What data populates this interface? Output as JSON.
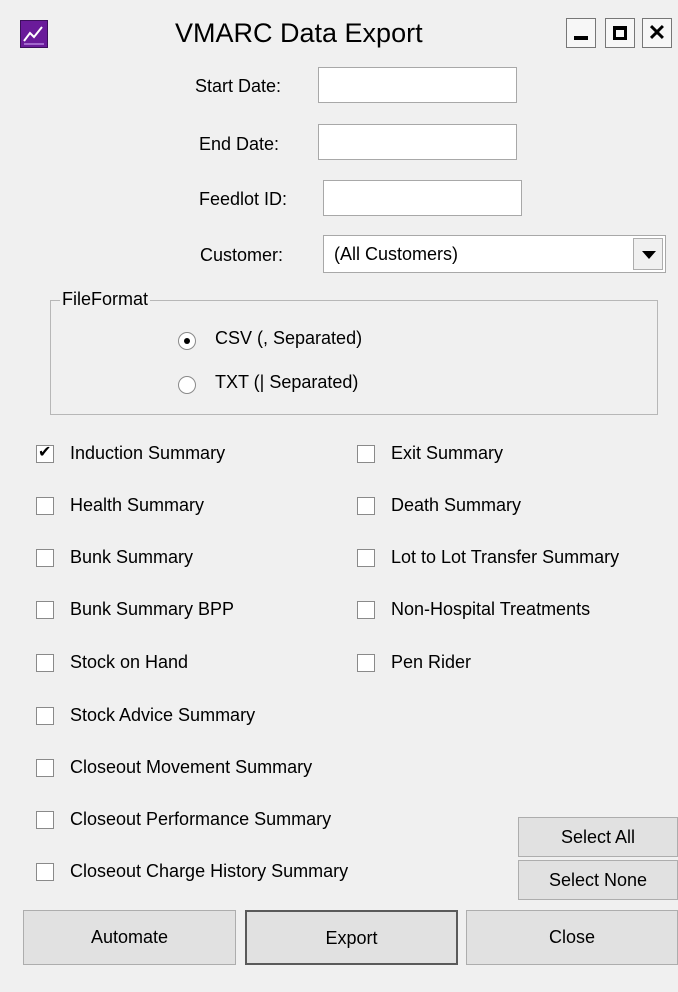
{
  "window": {
    "title": "VMARC Data Export",
    "icon": "chart-app-icon"
  },
  "title_buttons": {
    "minimize": "minimize-icon",
    "maximize": "maximize-icon",
    "close": "close-icon"
  },
  "fields": {
    "start_date": {
      "label": "Start Date:",
      "value": ""
    },
    "end_date": {
      "label": "End Date:",
      "value": ""
    },
    "feedlot_id": {
      "label": "Feedlot ID:",
      "value": ""
    },
    "customer": {
      "label": "Customer:",
      "value": "(All Customers)"
    }
  },
  "file_format": {
    "title": "FileFormat",
    "options": [
      {
        "label": "CSV  (, Separated)",
        "checked": true
      },
      {
        "label": "TXT  (| Separated)",
        "checked": false
      }
    ]
  },
  "reports_left": [
    {
      "label": "Induction Summary",
      "checked": true
    },
    {
      "label": "Health Summary",
      "checked": false
    },
    {
      "label": "Bunk Summary",
      "checked": false
    },
    {
      "label": "Bunk Summary BPP",
      "checked": false
    },
    {
      "label": "Stock on Hand",
      "checked": false
    },
    {
      "label": "Stock Advice Summary",
      "checked": false
    },
    {
      "label": "Closeout Movement Summary",
      "checked": false
    },
    {
      "label": "Closeout Performance Summary",
      "checked": false
    },
    {
      "label": "Closeout Charge History Summary",
      "checked": false
    }
  ],
  "reports_right": [
    {
      "label": "Exit Summary",
      "checked": false
    },
    {
      "label": "Death Summary",
      "checked": false
    },
    {
      "label": "Lot to Lot Transfer Summary",
      "checked": false
    },
    {
      "label": "Non-Hospital Treatments",
      "checked": false
    },
    {
      "label": "Pen Rider",
      "checked": false
    }
  ],
  "buttons": {
    "select_all": "Select All",
    "select_none": "Select None",
    "automate": "Automate",
    "export": "Export",
    "close": "Close"
  }
}
